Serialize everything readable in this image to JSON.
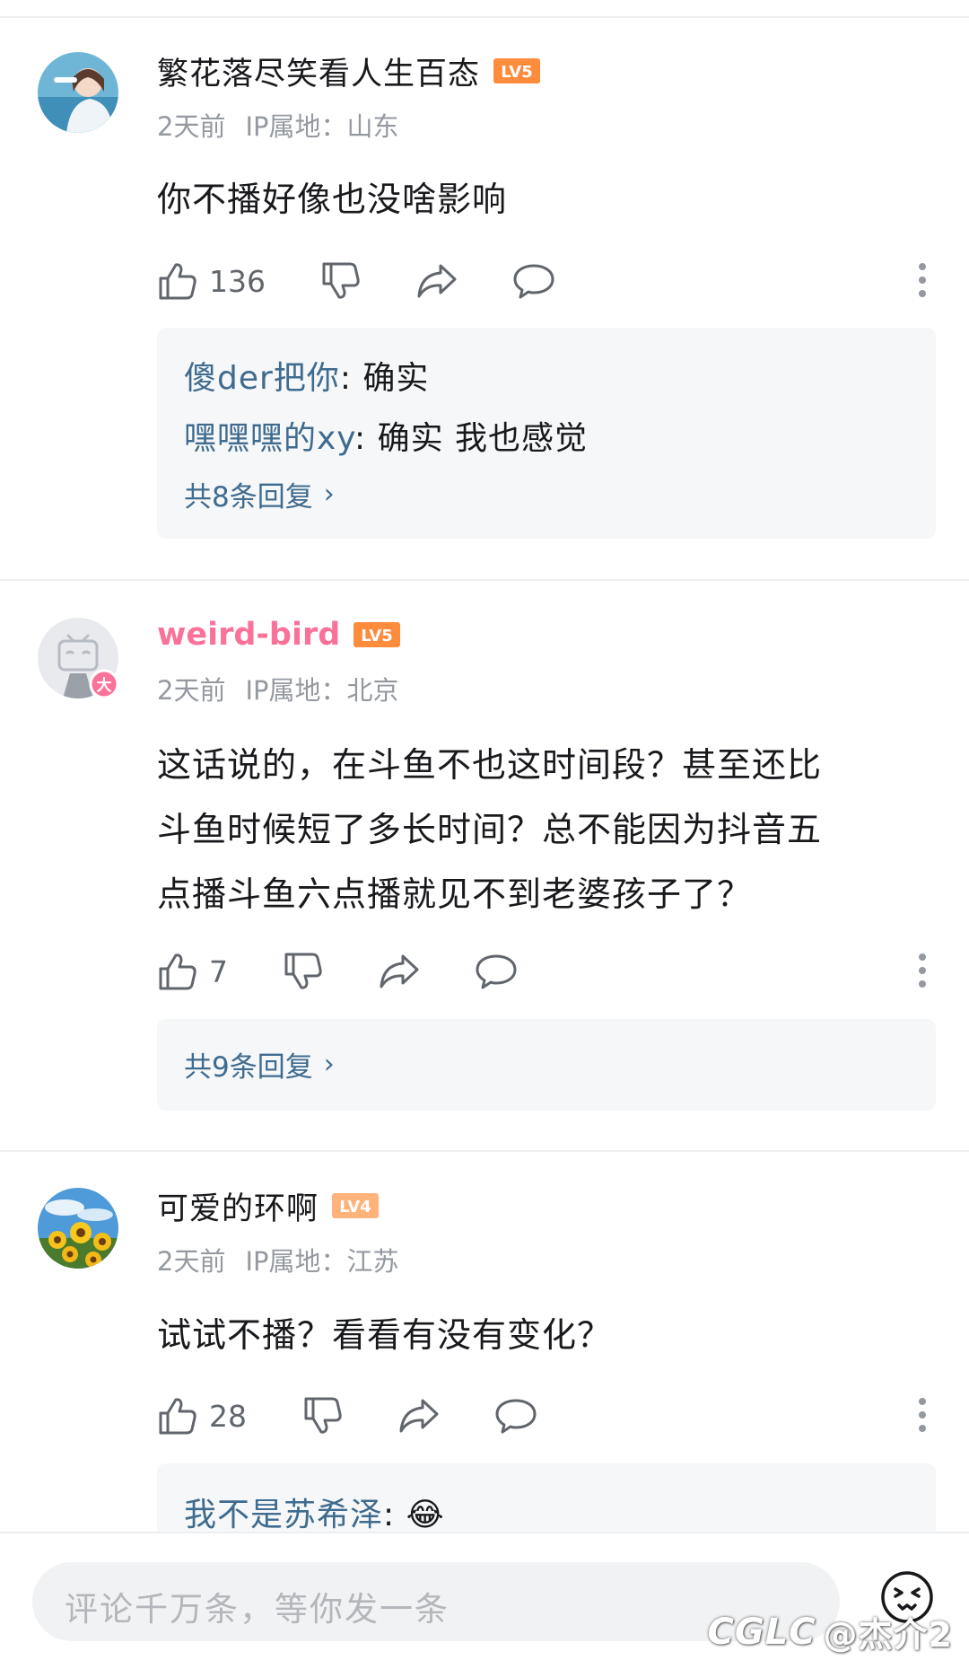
{
  "comments": [
    {
      "username": "繁花落尽笑看人生百态",
      "level": "LV5",
      "time": "2天前",
      "ip": "IP属地：山东",
      "text": "你不播好像也没啥影响",
      "likes": "136",
      "replies": [
        {
          "user": "傻der把你",
          "sep": ": ",
          "text": "确实"
        },
        {
          "user": "嘿嘿嘿的xy",
          "sep": ": ",
          "text": "确实  我也感觉"
        }
      ],
      "reply_more": "共8条回复"
    },
    {
      "username": "weird-bird",
      "level": "LV5",
      "time": "2天前",
      "ip": "IP属地：北京",
      "text_lines": [
        "这话说的，在斗鱼不也这时间段？甚至还比",
        "斗鱼时候短了多长时间？总不能因为抖音五",
        "点播斗鱼六点播就见不到老婆孩子了？"
      ],
      "likes": "7",
      "reply_more": "共9条回复",
      "vip_badge": "大"
    },
    {
      "username": "可爱的环啊",
      "level": "LV4",
      "time": "2天前",
      "ip": "IP属地：江苏",
      "text": "试试不播？看看有没有变化？",
      "likes": "28",
      "replies": [
        {
          "user": "我不是苏希泽",
          "sep": ": ",
          "text": "😂"
        }
      ]
    }
  ],
  "input": {
    "placeholder": "评论千万条，等你发一条"
  },
  "watermark": {
    "logo": "CGLC",
    "text": "@杰介2"
  },
  "colors": {
    "level5": "#ff8b3d",
    "level4": "#ffb37a",
    "vip_pink": "#fb7299",
    "reply_link": "#3f6b8f",
    "meta_gray": "#9499a0"
  }
}
